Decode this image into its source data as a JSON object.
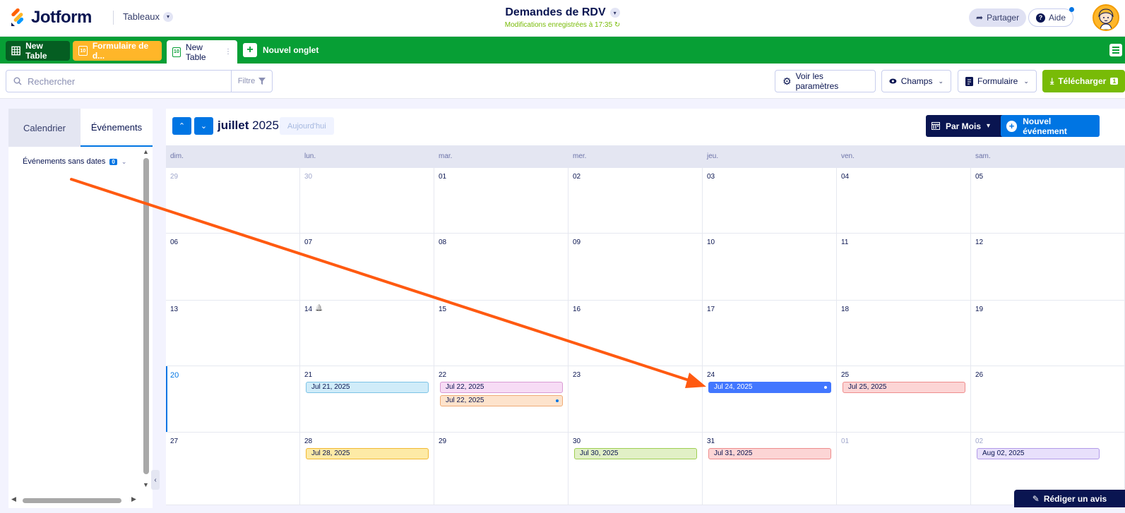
{
  "header": {
    "brand": "Jotform",
    "tables_menu": "Tableaux",
    "doc_title": "Demandes de RDV",
    "save_status": "Modifications enregistrées à 17:35",
    "share_label": "Partager",
    "help_label": "Aide"
  },
  "tabs": {
    "items": [
      {
        "label": "New Table",
        "icon": "grid-icon"
      },
      {
        "label": "Formulaire de d...",
        "icon": "calendar-icon"
      },
      {
        "label": "New Table",
        "icon": "calendar-icon"
      }
    ],
    "calendar_icon_number": "10",
    "add_label": "Nouvel onglet"
  },
  "toolbar": {
    "search_placeholder": "Rechercher",
    "filter_label": "Filtre",
    "settings_label": "Voir les paramètres",
    "fields_label": "Champs",
    "form_label": "Formulaire",
    "download_label": "Télécharger",
    "download_count": "1"
  },
  "sidebar": {
    "tab_calendar": "Calendrier",
    "tab_events": "Événements",
    "undated_label": "Événements sans dates",
    "undated_count": "0"
  },
  "calendar": {
    "month": "juillet",
    "year": "2025",
    "today_label": "Aujourd'hui",
    "view_label": "Par Mois",
    "new_event_label": "Nouvel événement",
    "weekdays": [
      "dim.",
      "lun.",
      "mar.",
      "mer.",
      "jeu.",
      "ven.",
      "sam."
    ],
    "weeks": [
      [
        {
          "d": "29",
          "m": 1
        },
        {
          "d": "30",
          "m": 1
        },
        {
          "d": "01"
        },
        {
          "d": "02"
        },
        {
          "d": "03"
        },
        {
          "d": "04"
        },
        {
          "d": "05"
        }
      ],
      [
        {
          "d": "06"
        },
        {
          "d": "07"
        },
        {
          "d": "08"
        },
        {
          "d": "09"
        },
        {
          "d": "10"
        },
        {
          "d": "11"
        },
        {
          "d": "12"
        }
      ],
      [
        {
          "d": "13"
        },
        {
          "d": "14",
          "bell": 1
        },
        {
          "d": "15"
        },
        {
          "d": "16"
        },
        {
          "d": "17"
        },
        {
          "d": "18"
        },
        {
          "d": "19"
        }
      ],
      [
        {
          "d": "20",
          "today": 1
        },
        {
          "d": "21"
        },
        {
          "d": "22"
        },
        {
          "d": "23"
        },
        {
          "d": "24"
        },
        {
          "d": "25"
        },
        {
          "d": "26"
        }
      ],
      [
        {
          "d": "27"
        },
        {
          "d": "28"
        },
        {
          "d": "29"
        },
        {
          "d": "30"
        },
        {
          "d": "31"
        },
        {
          "d": "01",
          "m": 1
        },
        {
          "d": "02",
          "m": 1
        }
      ]
    ],
    "events": [
      {
        "week": 3,
        "day": 1,
        "slot": 0,
        "label": "Jul 21, 2025",
        "bg": "#d0ecf9",
        "border": "#7cc3e6",
        "fg": "#0a1551"
      },
      {
        "week": 3,
        "day": 2,
        "slot": 0,
        "label": "Jul 22, 2025",
        "bg": "#f7dcf5",
        "border": "#d99bd4",
        "fg": "#0a1551"
      },
      {
        "week": 3,
        "day": 2,
        "slot": 1,
        "label": "Jul 22, 2025",
        "bg": "#fde3cc",
        "border": "#f0ab76",
        "fg": "#0a1551",
        "dot": "#0075e3"
      },
      {
        "week": 3,
        "day": 4,
        "slot": 0,
        "label": "Jul 24, 2025",
        "bg": "#4277ff",
        "border": "#4277ff",
        "fg": "#ffffff",
        "dot": "#ffffff"
      },
      {
        "week": 3,
        "day": 5,
        "slot": 0,
        "label": "Jul 25, 2025",
        "bg": "#fcd5d5",
        "border": "#ee8d8d",
        "fg": "#0a1551"
      },
      {
        "week": 4,
        "day": 1,
        "slot": 0,
        "label": "Jul 28, 2025",
        "bg": "#fdeaa6",
        "border": "#f2b934",
        "fg": "#0a1551"
      },
      {
        "week": 4,
        "day": 3,
        "slot": 0,
        "label": "Jul 30, 2025",
        "bg": "#e1f0c6",
        "border": "#9fce53",
        "fg": "#0a1551"
      },
      {
        "week": 4,
        "day": 4,
        "slot": 0,
        "label": "Jul 31, 2025",
        "bg": "#fcd5d5",
        "border": "#ee8d8d",
        "fg": "#0a1551"
      },
      {
        "week": 4,
        "day": 6,
        "slot": 0,
        "label": "Aug 02, 2025",
        "bg": "#e8e0fb",
        "border": "#b29be8",
        "fg": "#0a1551"
      }
    ]
  },
  "feedback_label": "Rédiger un avis",
  "colors": {
    "brand_green": "#079f35",
    "accent_blue": "#0075e3",
    "navy": "#0a1551",
    "download_green": "#78bb07",
    "annotation_arrow": "#ff5a11"
  }
}
